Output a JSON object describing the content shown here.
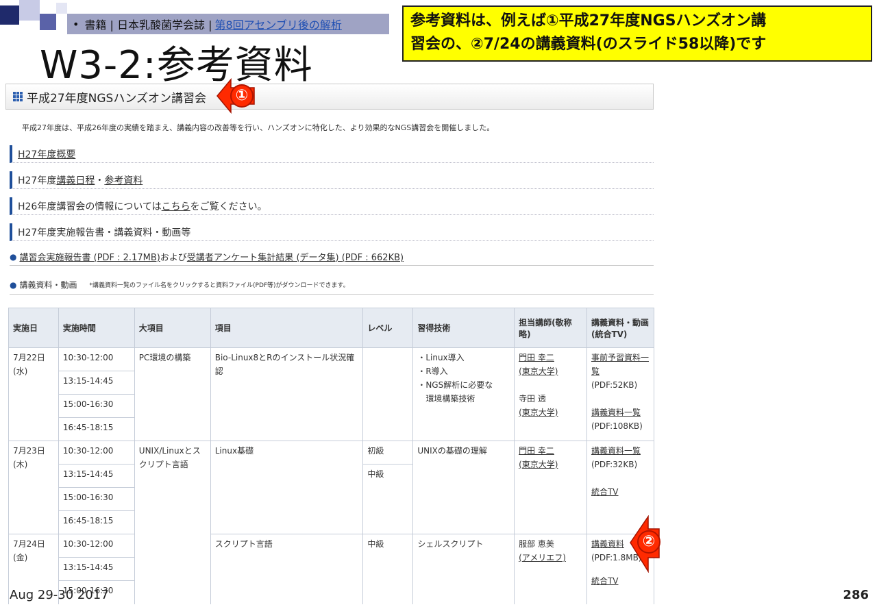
{
  "slide": {
    "title": "W3-2:参考資料",
    "reference_bullet": "•",
    "reference_text": "書籍 | 日本乳酸菌学会誌 |",
    "reference_link": "第8回アセンブリ後の解析",
    "callout_line1": "参考資料は、例えば①平成27年度NGSハンズオン講",
    "callout_line2": "習会の、②7/24の講義資料(のスライド58以降)です",
    "footer_date": "Aug 29-30 2017",
    "page_number": "286",
    "marker1": "①",
    "marker2": "②"
  },
  "page": {
    "section_title": "平成27年度NGSハンズオン講習会",
    "intro": "平成27年度は、平成26年度の実績を踏まえ、講義内容の改善等を行い、ハンズオンに特化した、より効果的なNGS講習会を開催しました。",
    "nav": {
      "overview": "H27年度概要",
      "schedule_prefix": "H27年度",
      "schedule_link": "講義日程",
      "schedule_sep": "・",
      "reference_link": "参考資料",
      "h26_prefix": "H26年度講習会の情報については",
      "h26_link": "こちら",
      "h26_suffix": "をご覧ください。",
      "reports": "H27年度実施報告書・講義資料・動画等"
    },
    "report_line": {
      "bullet": "●",
      "link1": "講習会実施報告書 (PDF : 2.17MB)",
      "mid": " および",
      "link2": "受講者アンケート集計結果 (データ集) (PDF : 662KB)"
    },
    "materials": {
      "bullet": "●",
      "label": "講義資料・動画",
      "note": "*講義資料一覧のファイル名をクリックすると資料ファイル(PDF等)がダウンロードできます。"
    },
    "table": {
      "headers": [
        "実施日",
        "実施時間",
        "大項目",
        "項目",
        "レベル",
        "習得技術",
        "担当講師(敬称略)",
        "講義資料・動画(統合TV)"
      ],
      "day1": {
        "date": "7月22日",
        "weekday": "(水)",
        "times": [
          "10:30-12:00",
          "13:15-14:45",
          "15:00-16:30",
          "16:45-18:15"
        ],
        "category": "PC環境の構築",
        "item": "Bio-Linux8とRのインストール状況確認",
        "level": "",
        "skills": [
          "・Linux導入",
          "・R導入",
          "・NGS解析に必要な",
          "環境構築技術"
        ],
        "lecturer1": "門田 幸二",
        "affil1": "(東京大学)",
        "lecturer2": "寺田 透",
        "affil2": "(東京大学)",
        "mat1": "事前予習資料一覧",
        "mat1_size": "(PDF:52KB)",
        "mat2": "講義資料一覧",
        "mat2_size": "(PDF:108KB)"
      },
      "day2": {
        "date": "7月23日",
        "weekday": "(木)",
        "times": [
          "10:30-12:00",
          "13:15-14:45",
          "15:00-16:30",
          "16:45-18:15"
        ],
        "category": "UNIX/Linuxとスクリプト言語",
        "item": "Linux基礎",
        "levels": [
          "初級",
          "中級"
        ],
        "skill": "UNIXの基礎の理解",
        "lecturer": "門田 幸二",
        "affil": "(東京大学)",
        "mat1": "講義資料一覧",
        "mat1_size": "(PDF:32KB)",
        "mat2": "統合TV"
      },
      "day3": {
        "date": "7月24日",
        "weekday": "(金)",
        "times": [
          "10:30-12:00",
          "13:15-14:45",
          "15:00-16:30"
        ],
        "item": "スクリプト言語",
        "level": "中級",
        "skill": "シェルスクリプト",
        "lecturer": "服部 恵美",
        "affil": "(アメリエフ)",
        "mat1": "講義資料",
        "mat1_size": "(PDF:1.8MB)",
        "mat2": "統合TV"
      }
    }
  }
}
